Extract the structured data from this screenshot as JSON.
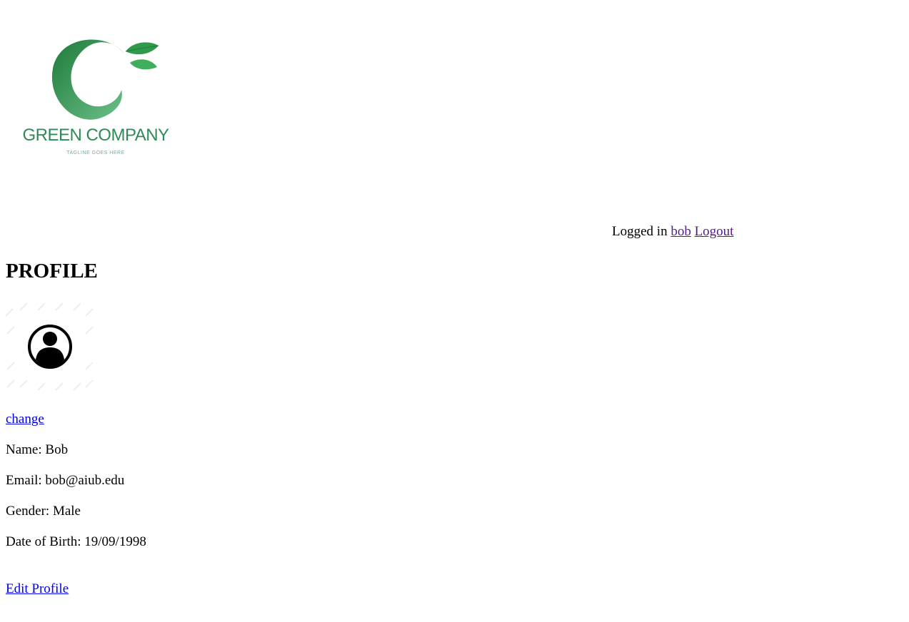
{
  "logo": {
    "name": "GREEN COMPANY",
    "tagline": "TAGLINE GOES HERE"
  },
  "header": {
    "logged_in_text": "Logged in",
    "username": "bob",
    "logout_label": "Logout"
  },
  "page": {
    "title": "PROFILE"
  },
  "avatar": {
    "icon": "user-circle-icon",
    "change_label": "change"
  },
  "profile": {
    "name_label": "Name:",
    "name_value": "Bob",
    "email_label": "Email:",
    "email_value": "bob@aiub.edu",
    "gender_label": "Gender:",
    "gender_value": "Male",
    "dob_label": "Date of Birth:",
    "dob_value": "19/09/1998"
  },
  "actions": {
    "edit_profile_label": "Edit Profile"
  },
  "colors": {
    "link": "#0000ee",
    "visited_link": "#551a8b",
    "brand_green": "#2e8b57"
  }
}
